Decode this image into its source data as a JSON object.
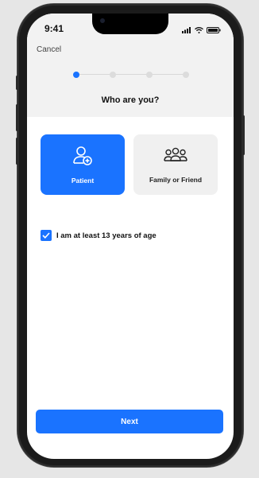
{
  "status_bar": {
    "time": "9:41"
  },
  "nav": {
    "cancel_label": "Cancel"
  },
  "stepper": {
    "steps": 4,
    "current_step": 1
  },
  "page": {
    "title": "Who are you?"
  },
  "options": [
    {
      "label": "Patient",
      "icon": "user-plus-icon",
      "selected": true
    },
    {
      "label": "Family or Friend",
      "icon": "group-icon",
      "selected": false
    }
  ],
  "consent": {
    "label": "I am at least 13 years of age",
    "checked": true
  },
  "actions": {
    "next_label": "Next"
  },
  "colors": {
    "accent": "#1a73ff",
    "header_bg": "#f2f2f2",
    "card_inactive": "#f0f0f0"
  }
}
